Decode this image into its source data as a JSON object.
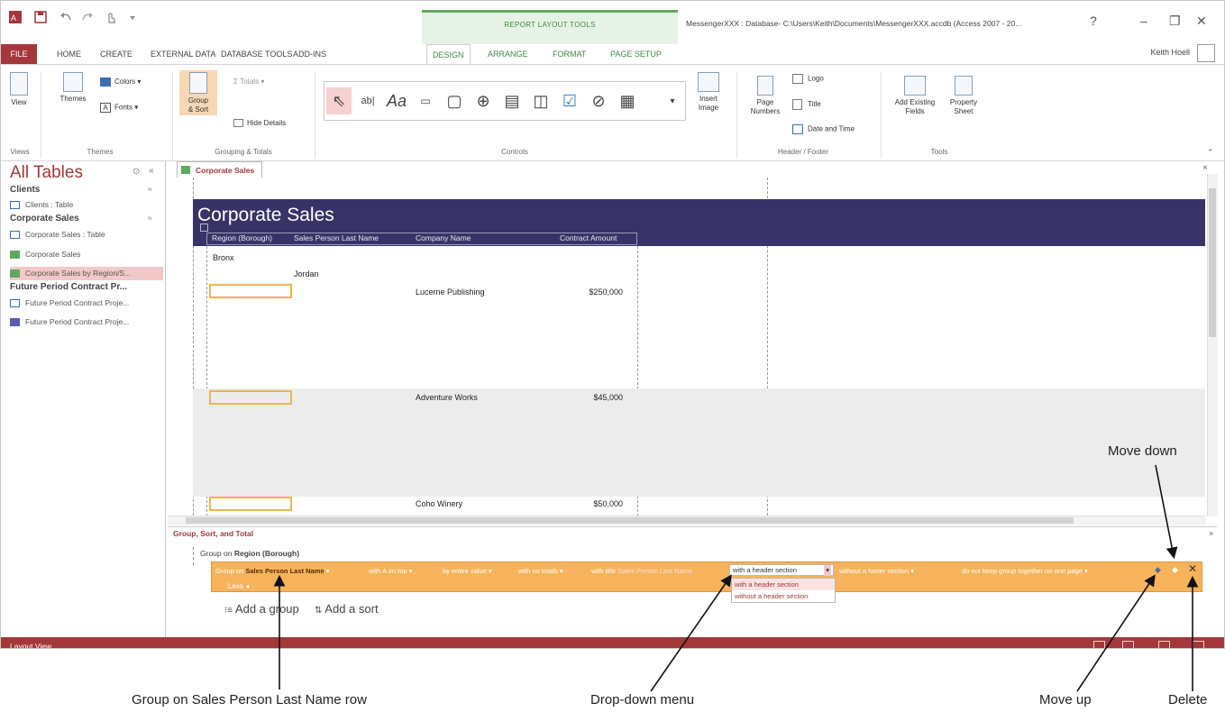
{
  "window": {
    "title": "MessengerXXX : Database- C:\\Users\\Keith\\Documents\\MessengerXXX.accdb (Access 2007 - 20...",
    "context_title": "REPORT LAYOUT TOOLS",
    "help": "?",
    "user": "Keith Hoell"
  },
  "tabs": [
    "FILE",
    "HOME",
    "CREATE",
    "EXTERNAL DATA",
    "DATABASE TOOLS",
    "ADD-INS",
    "DESIGN",
    "ARRANGE",
    "FORMAT",
    "PAGE SETUP"
  ],
  "ribbon": {
    "view": "View",
    "themes": "Themes",
    "colors": "Colors",
    "fonts": "Fonts",
    "group_sort_1": "Group",
    "group_sort_2": "& Sort",
    "totals": "Totals",
    "hide_details": "Hide Details",
    "insert_image_1": "Insert",
    "insert_image_2": "Image",
    "page_numbers_1": "Page",
    "page_numbers_2": "Numbers",
    "logo": "Logo",
    "title": "Title",
    "date_time": "Date and Time",
    "add_fields_1": "Add Existing",
    "add_fields_2": "Fields",
    "property_1": "Property",
    "property_2": "Sheet",
    "groups": {
      "views": "Views",
      "themes": "Themes",
      "grouping": "Grouping & Totals",
      "controls": "Controls",
      "header_footer": "Header / Footer",
      "tools": "Tools"
    }
  },
  "nav": {
    "title": "All Tables",
    "sections": [
      {
        "header": "Clients",
        "items": [
          "Clients : Table"
        ]
      },
      {
        "header": "Corporate Sales",
        "items": [
          "Corporate Sales : Table",
          "Corporate Sales",
          "Corporate Sales by Region/S..."
        ]
      },
      {
        "header": "Future Period Contract Pr...",
        "items": [
          "Future Period Contract Proje...",
          "Future Period Contract Proje..."
        ]
      }
    ]
  },
  "document": {
    "tab": "Corporate Sales",
    "report_title": "Corporate Sales",
    "columns": [
      "Region (Borough)",
      "Sales Person Last Name",
      "Company Name",
      "Contract Amount"
    ],
    "region": "Bronx",
    "salesperson": "Jordan",
    "rows": [
      {
        "company": "Lucerne Publishing",
        "amount": "$250,000"
      },
      {
        "company": "Adventure Works",
        "amount": "$45,000"
      },
      {
        "company": "Coho Winery",
        "amount": "$50,000"
      }
    ]
  },
  "gst": {
    "title": "Group, Sort, and Total",
    "group1_prefix": "Group on",
    "group1_field": "Region (Borough)",
    "row_prefix": "Group on",
    "row_field": "Sales Person Last Name",
    "sort_order": "with A on top",
    "by_value": "by entire value",
    "totals": "with no totals",
    "title_prefix": "with title",
    "title_value": "Sales Person Last Name",
    "header_section": "with a header section",
    "footer_section": "without a footer section",
    "keep_together": "do not keep group together on one page",
    "less": "Less",
    "dropdown_options": [
      "with a header section",
      "without a header section"
    ],
    "add_group": "Add a group",
    "add_sort": "Add a sort"
  },
  "status": {
    "text": "Layout View"
  },
  "callouts": {
    "group_row": "Group on Sales Person Last Name row",
    "dropdown": "Drop-down menu",
    "move_up": "Move up",
    "delete": "Delete",
    "move_down": "Move down"
  },
  "colors": {
    "access_red": "#a4373a",
    "report_header": "#383367",
    "context_green": "#3d8c40",
    "orange_row": "#f6b35b"
  }
}
